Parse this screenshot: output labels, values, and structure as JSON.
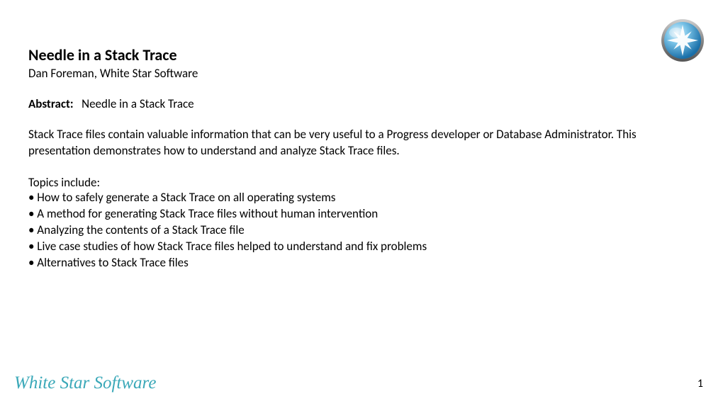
{
  "title": "Needle in a Stack Trace",
  "author": "Dan Foreman, White Star Software",
  "abstract": {
    "label": "Abstract:",
    "value": "Needle in a Stack Trace"
  },
  "description": "Stack Trace files contain valuable information that can be very useful to a Progress developer or Database Administrator. This presentation demonstrates how to understand and analyze Stack Trace files.",
  "topicsHeading": "Topics include:",
  "topics": [
    "• How to safely generate a Stack Trace on all operating systems",
    "• A method for generating Stack Trace files without human intervention",
    "• Analyzing the contents of a Stack Trace file",
    "• Live case studies of how Stack Trace files helped to understand and fix problems",
    "• Alternatives to Stack Trace files"
  ],
  "footerLogo": "White Star Software",
  "pageNumber": "1",
  "logoIcon": "snowflake-star-icon"
}
